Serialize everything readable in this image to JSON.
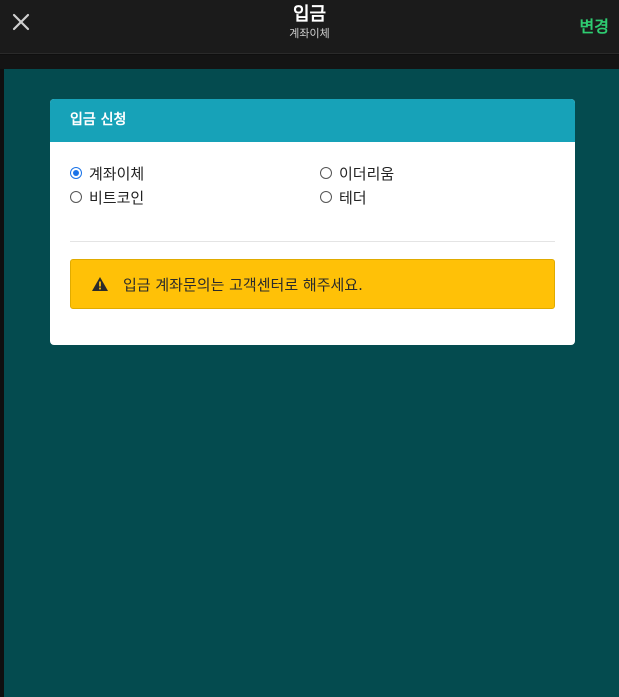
{
  "header": {
    "title": "입금",
    "subtitle": "계좌이체",
    "change_label": "변경"
  },
  "card": {
    "title": "입금 신청",
    "options": [
      {
        "label": "계좌이체",
        "checked": true
      },
      {
        "label": "이더리움",
        "checked": false
      },
      {
        "label": "비트코인",
        "checked": false
      },
      {
        "label": "테더",
        "checked": false
      }
    ],
    "alert_text": "입금 계좌문의는 고객센터로 해주세요."
  },
  "colors": {
    "topbar": "#1b1b1b",
    "content_bg": "#044b4f",
    "card_header": "#17a2b8",
    "alert_bg": "#ffc107",
    "accent_green": "#2ecc71"
  },
  "icons": {
    "close": "close-icon",
    "warning": "warning-icon"
  }
}
